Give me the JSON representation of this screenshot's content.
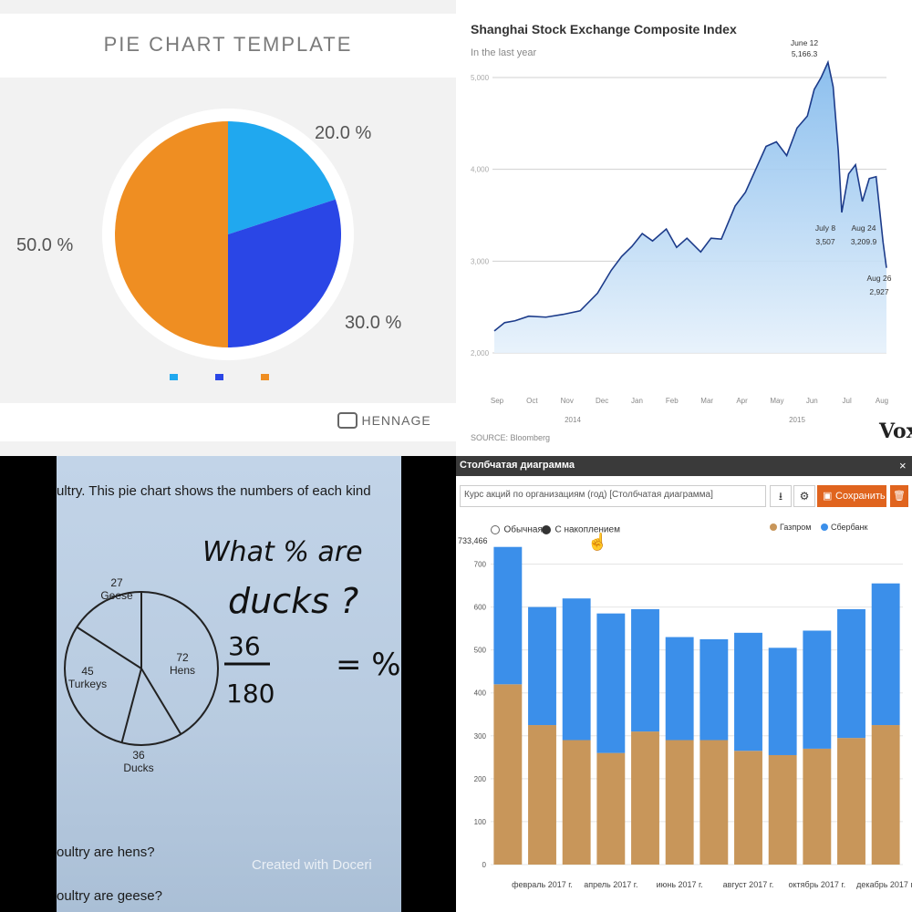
{
  "pie_template": {
    "title": "PIE CHART TEMPLATE",
    "brand": "HENNAGE",
    "legend": [
      "",
      "",
      " "
    ],
    "colors": [
      "#20a8ef",
      "#2a46e6",
      "#ef8e22"
    ]
  },
  "shanghai": {
    "title": "Shanghai Stock Exchange Composite Index",
    "subtitle": "In the last year",
    "source": "SOURCE: Bloomberg",
    "brand": "Vox",
    "years": [
      "2014",
      "2015"
    ],
    "annotations": [
      {
        "label": "June 12",
        "value": "5,166.3"
      },
      {
        "label": "July 8",
        "value": "3,507"
      },
      {
        "label": "Aug 24",
        "value": "3,209.9"
      },
      {
        "label": "Aug 26",
        "value": "2,927"
      }
    ]
  },
  "poultry": {
    "line1": "ultry. This pie chart shows the numbers of each kind",
    "slices": [
      {
        "value": "27",
        "name": "Geese"
      },
      {
        "value": "72",
        "name": "Hens"
      },
      {
        "value": "36",
        "name": "Ducks"
      },
      {
        "value": "45",
        "name": "Turkeys"
      }
    ],
    "question_line1": "What % are",
    "question_line2": "ducks ?",
    "fraction_num": "36",
    "fraction_den": "180",
    "equals": "= %",
    "q_hens": "oultry are hens?",
    "q_geese": "oultry are geese?",
    "watermark": "Created with Doceri"
  },
  "bar_app": {
    "window_title": "Столбчатая диаграмма",
    "input_value": "Курс акций по организациям (год) [Столбчатая диаграмма]",
    "save_label": "Сохранить",
    "radio_normal": "Обычная",
    "radio_stacked": "С накоплением",
    "max_label": "733,466",
    "colors": {
      "gazprom": "#c8965a",
      "sberbank": "#3b8fea"
    }
  },
  "chart_data": [
    {
      "type": "pie",
      "title": "PIE CHART TEMPLATE",
      "values": [
        20,
        30,
        50
      ],
      "labels": [
        "20.0 %",
        "30.0 %",
        "50.0 %"
      ],
      "colors": [
        "#20a8ef",
        "#2a46e6",
        "#ef8e22"
      ]
    },
    {
      "type": "area",
      "title": "Shanghai Stock Exchange Composite Index",
      "subtitle": "In the last year",
      "x_ticks": [
        "Sep",
        "Oct",
        "Nov",
        "Dec",
        "Jan",
        "Feb",
        "Mar",
        "Apr",
        "May",
        "Jun",
        "Jul",
        "Aug"
      ],
      "y_ticks": [
        "2,000",
        "3,000",
        "4,000",
        "5,000"
      ],
      "ylim": [
        2000,
        5000
      ],
      "x": [
        0,
        0.3,
        0.6,
        1,
        1.5,
        2,
        2.5,
        3,
        3.4,
        3.7,
        4,
        4.3,
        4.6,
        5,
        5.3,
        5.6,
        6,
        6.3,
        6.6,
        7,
        7.3,
        7.6,
        7.9,
        8.2,
        8.5,
        8.8,
        9.1,
        9.3,
        9.5,
        9.7,
        9.85,
        10,
        10.1,
        10.3,
        10.5,
        10.7,
        10.9,
        11.1,
        11.3,
        11.4
      ],
      "values": [
        2240,
        2330,
        2350,
        2400,
        2390,
        2420,
        2460,
        2650,
        2900,
        3050,
        3160,
        3300,
        3220,
        3350,
        3150,
        3250,
        3100,
        3250,
        3240,
        3600,
        3750,
        4000,
        4250,
        4300,
        4150,
        4450,
        4580,
        4870,
        5000,
        5166,
        4900,
        4200,
        3530,
        3950,
        4050,
        3650,
        3900,
        3920,
        3210,
        2927
      ],
      "annotations": [
        {
          "x": 9.7,
          "label": "June 12",
          "value": 5166.3
        },
        {
          "x": 10.1,
          "label": "July 8",
          "value": 3507
        },
        {
          "x": 11.3,
          "label": "Aug 24",
          "value": 3209.9
        },
        {
          "x": 11.4,
          "label": "Aug 26",
          "value": 2927
        }
      ]
    },
    {
      "type": "pie",
      "categories": [
        "Geese",
        "Hens",
        "Ducks",
        "Turkeys"
      ],
      "values": [
        27,
        72,
        36,
        45
      ]
    },
    {
      "type": "bar",
      "stacked": true,
      "ylim": [
        0,
        750
      ],
      "y_ticks": [
        0,
        100,
        200,
        300,
        400,
        500,
        600,
        700
      ],
      "x_tick_labels": [
        "февраль 2017 г.",
        "апрель 2017 г.",
        "июнь 2017 г.",
        "август 2017 г.",
        "октябрь 2017 г.",
        "декабрь 2017 г."
      ],
      "series": [
        {
          "name": "Газпром",
          "values": [
            420,
            325,
            290,
            260,
            310,
            290,
            290,
            265,
            255,
            270,
            295,
            325
          ]
        },
        {
          "name": "Сбербанк",
          "values": [
            320,
            275,
            330,
            325,
            285,
            240,
            235,
            275,
            250,
            275,
            300,
            330
          ]
        }
      ]
    }
  ]
}
